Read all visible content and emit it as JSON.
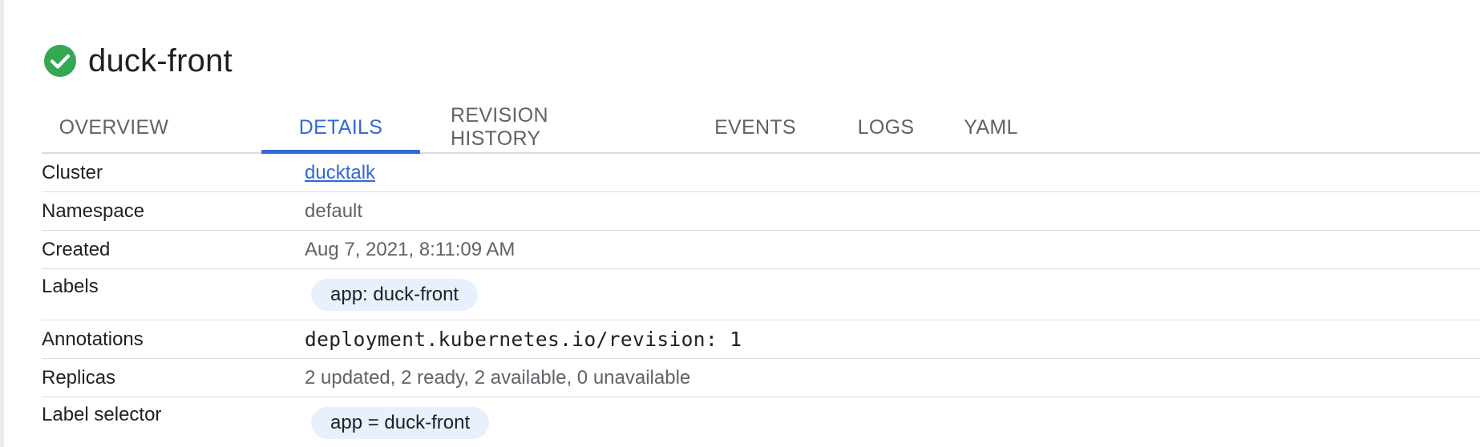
{
  "title": "duck-front",
  "status": {
    "icon": "check-circle-icon",
    "color": "#34a853"
  },
  "tabs": [
    {
      "label": "OVERVIEW"
    },
    {
      "label": "DETAILS"
    },
    {
      "label": "REVISION HISTORY"
    },
    {
      "label": "EVENTS"
    },
    {
      "label": "LOGS"
    },
    {
      "label": "YAML"
    }
  ],
  "active_tab": "DETAILS",
  "details": {
    "cluster": {
      "label": "Cluster",
      "value": "ducktalk"
    },
    "namespace": {
      "label": "Namespace",
      "value": "default"
    },
    "created": {
      "label": "Created",
      "value": "Aug 7, 2021, 8:11:09 AM"
    },
    "labels": {
      "label": "Labels",
      "value": "app: duck-front"
    },
    "annotations": {
      "label": "Annotations",
      "value": "deployment.kubernetes.io/revision: 1"
    },
    "replicas": {
      "label": "Replicas",
      "value": "2 updated, 2 ready, 2 available, 0 unavailable"
    },
    "label_selector": {
      "label": "Label selector",
      "value": "app = duck-front"
    }
  },
  "colors": {
    "accent": "#3367d6",
    "chip_bg": "#e8f0fe",
    "divider": "#dadce0",
    "success": "#34a853"
  }
}
